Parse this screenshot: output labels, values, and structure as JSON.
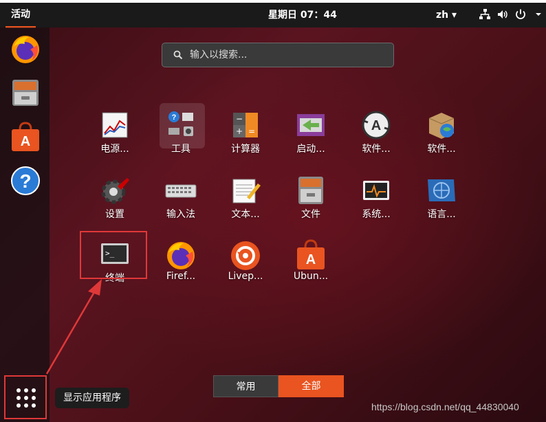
{
  "topbar": {
    "activities": "活动",
    "clock": "星期日 07：44",
    "lang": "zh ▾"
  },
  "dock": {
    "items": [
      "firefox-icon",
      "files-icon",
      "software-icon",
      "help-icon"
    ],
    "show_apps_tooltip": "显示应用程序"
  },
  "search": {
    "placeholder": "输入以搜索..."
  },
  "apps": [
    {
      "label": "电源..."
    },
    {
      "label": "工具"
    },
    {
      "label": "计算器"
    },
    {
      "label": "启动..."
    },
    {
      "label": "软件..."
    },
    {
      "label": "软件..."
    },
    {
      "label": "设置"
    },
    {
      "label": "输入法"
    },
    {
      "label": "文本..."
    },
    {
      "label": "文件"
    },
    {
      "label": "系统..."
    },
    {
      "label": "语言..."
    },
    {
      "label": "终端"
    },
    {
      "label": "Firef..."
    },
    {
      "label": "Livep..."
    },
    {
      "label": "Ubun..."
    }
  ],
  "tabs": {
    "frequent": "常用",
    "all": "全部"
  },
  "watermark": "https://blog.csdn.net/qq_44830040",
  "colors": {
    "accent": "#e95420",
    "highlight": "#e03838"
  }
}
